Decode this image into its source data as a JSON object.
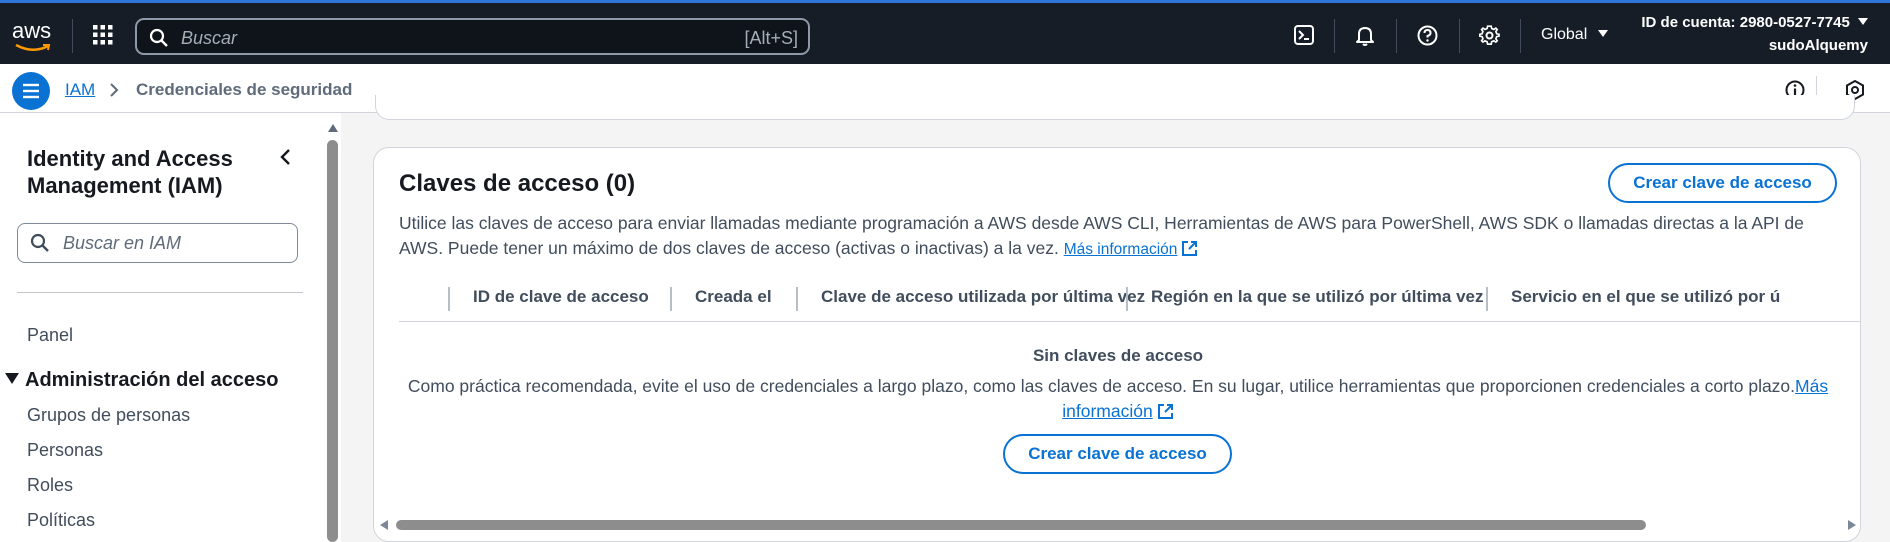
{
  "topnav": {
    "logo": "aws",
    "search_placeholder": "Buscar",
    "search_shortcut": "[Alt+S]",
    "region": "Global",
    "account_label": "ID de cuenta: 2980-0527-7745",
    "username": "sudoAlquemy",
    "icons": [
      "grid-apps-icon",
      "search-icon",
      "cloudshell-icon",
      "bell-icon",
      "help-icon",
      "gear-icon",
      "chevron-down-icon"
    ]
  },
  "breadcrumb": {
    "items": [
      "IAM",
      "Credenciales de seguridad"
    ]
  },
  "sidebar": {
    "title": "Identity and Access Management (IAM)",
    "search_placeholder": "Buscar en IAM",
    "panel": "Panel",
    "section": "Administración del acceso",
    "links": [
      "Grupos de personas",
      "Personas",
      "Roles",
      "Políticas"
    ]
  },
  "access_keys": {
    "title": "Claves de acceso (0)",
    "create_button": "Crear clave de acceso",
    "description": "Utilice las claves de acceso para enviar llamadas mediante programación a AWS desde AWS CLI, Herramientas de AWS para PowerShell, AWS SDK o llamadas directas a la API de AWS. Puede tener un máximo de dos claves de acceso (activas o inactivas) a la vez.",
    "more_info": "Más información",
    "columns": [
      "ID de clave de acceso",
      "Creada el",
      "Clave de acceso utilizada por última vez",
      "Región en la que se utilizó por última vez",
      "Servicio en el que se utilizó por ú"
    ],
    "empty_title": "Sin claves de acceso",
    "empty_text": "Como práctica recomendada, evite el uso de credenciales a largo plazo, como las claves de acceso. En su lugar, utilice herramientas que proporcionen credenciales a corto plazo.",
    "empty_link": "Más información",
    "empty_button": "Crear clave de acceso"
  },
  "colors": {
    "nav_bg": "#161d26",
    "accent": "#0972d3",
    "page_bg": "#f4f4f4"
  }
}
